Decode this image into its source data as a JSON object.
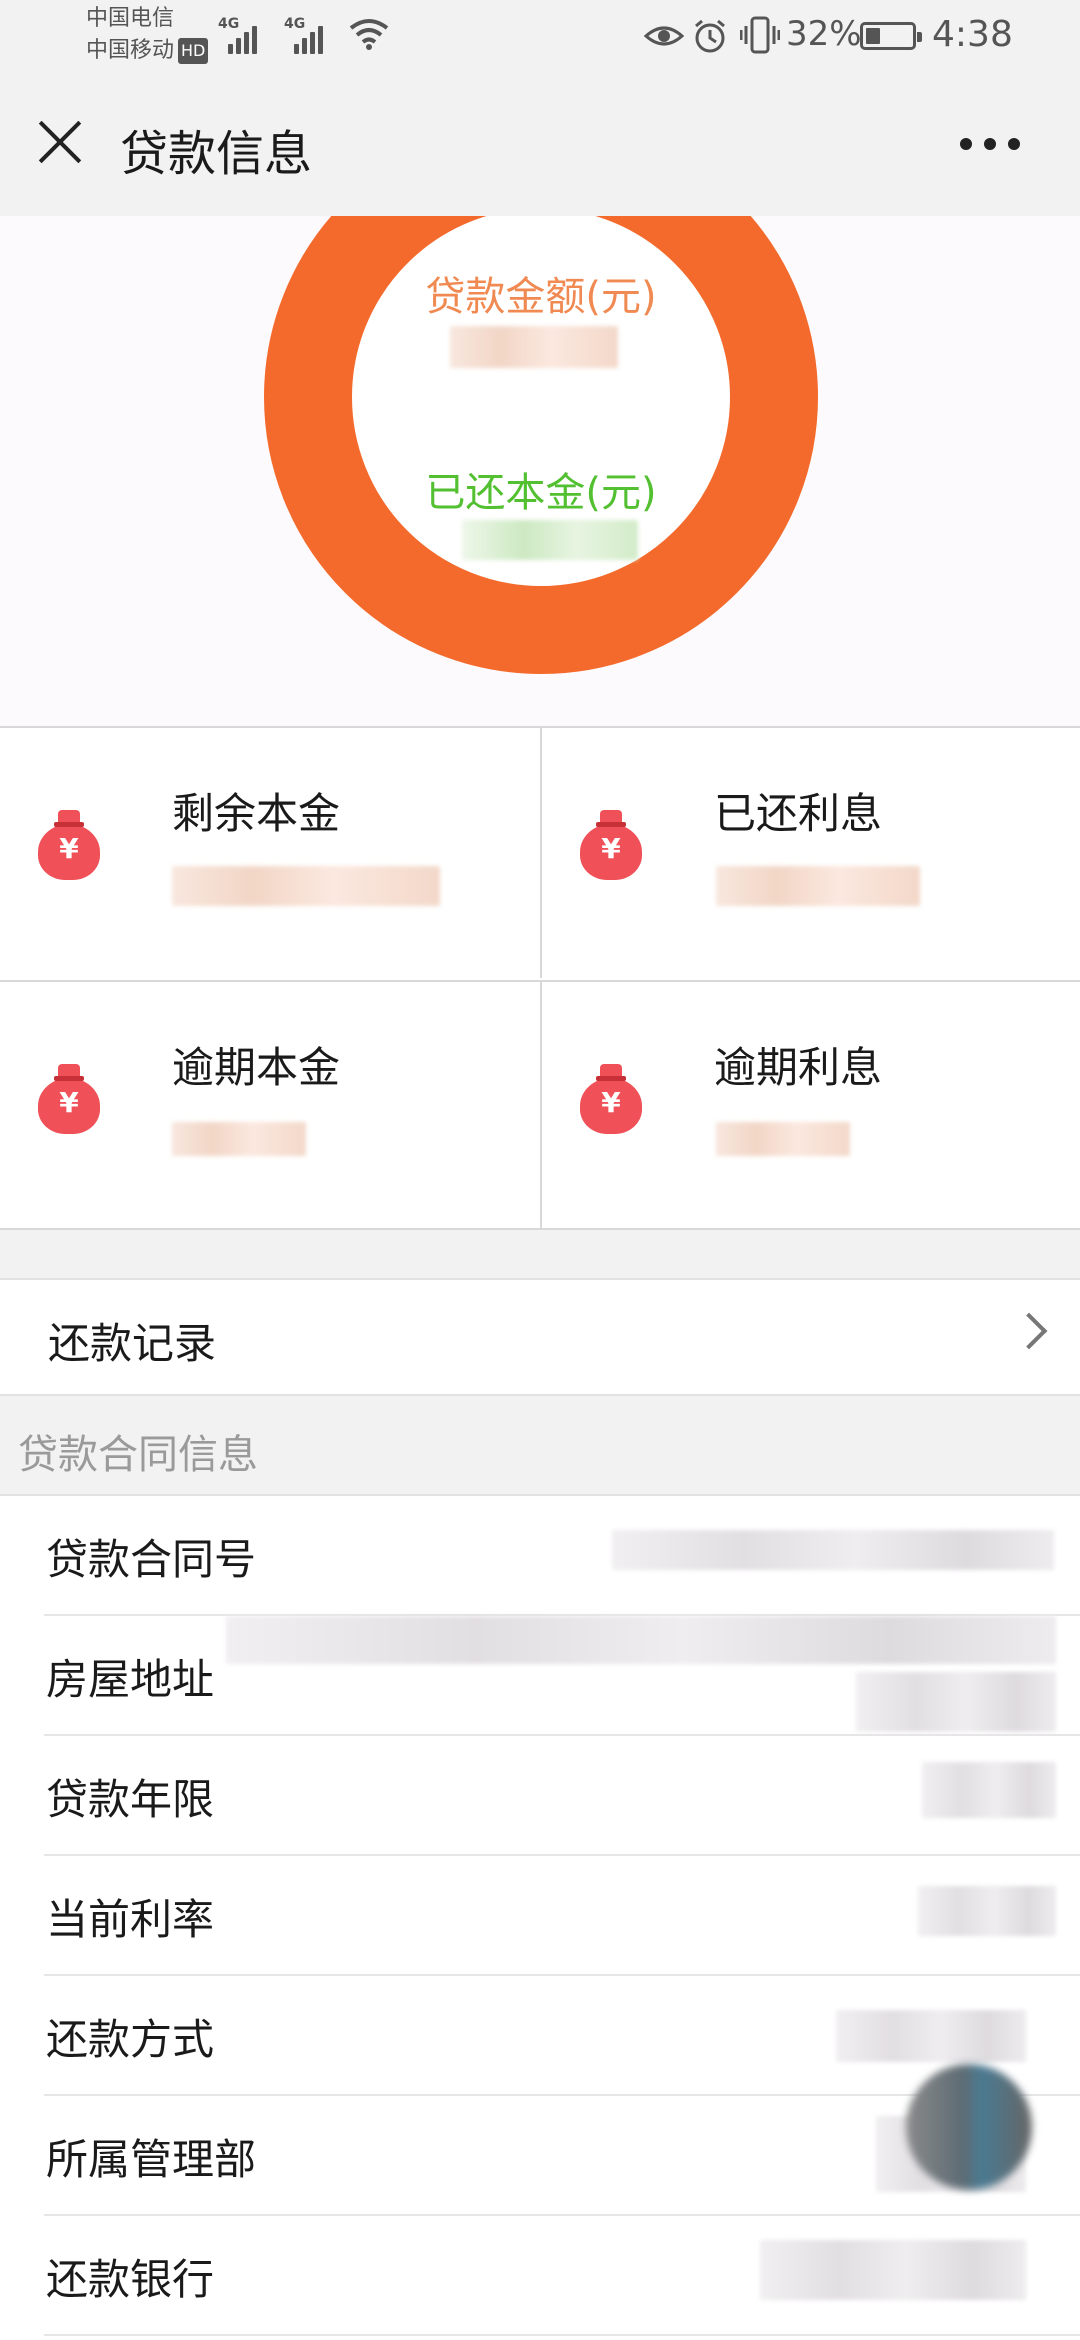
{
  "status_bar": {
    "carrier_1": "中国电信",
    "carrier_2": "中国移动",
    "hd_badge": "HD",
    "network_1": "4G",
    "network_2": "4G",
    "battery_percent": "32%",
    "battery_level": 0.32,
    "time": "4:38"
  },
  "nav": {
    "title": "贷款信息"
  },
  "summary": {
    "loan_amount_label": "贷款金额(元)",
    "repaid_principal_label": "已还本金(元)"
  },
  "stats": [
    {
      "label": "剩余本金"
    },
    {
      "label": "已还利息"
    },
    {
      "label": "逾期本金"
    },
    {
      "label": "逾期利息"
    }
  ],
  "bag_symbol": "¥",
  "repayment_record": {
    "label": "还款记录"
  },
  "contract_section": {
    "title": "贷款合同信息",
    "rows": [
      {
        "label": "贷款合同号"
      },
      {
        "label": "房屋地址"
      },
      {
        "label": "贷款年限"
      },
      {
        "label": "当前利率"
      },
      {
        "label": "还款方式"
      },
      {
        "label": "所属管理部"
      },
      {
        "label": "还款银行"
      }
    ]
  }
}
